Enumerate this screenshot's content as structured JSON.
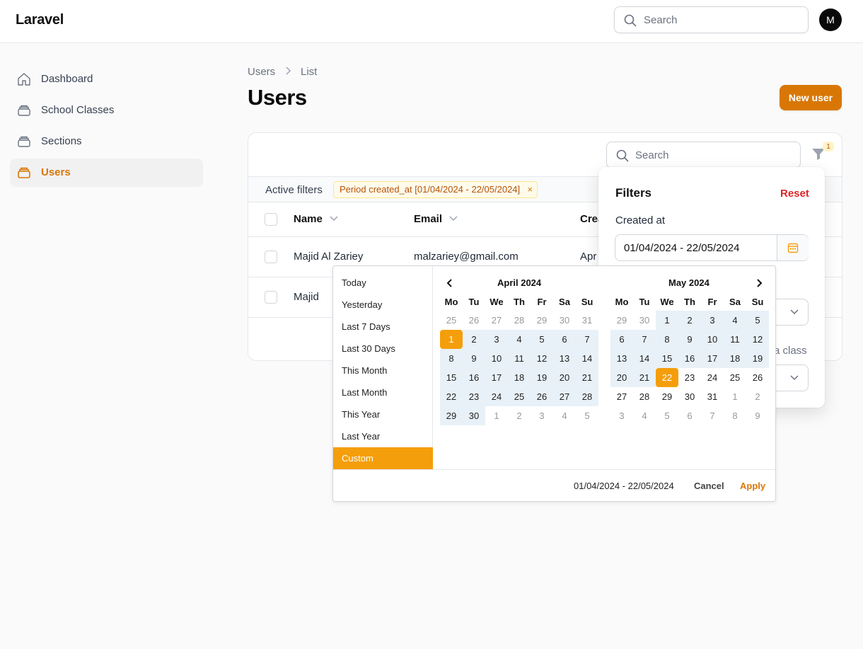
{
  "app": {
    "brand": "Laravel",
    "avatar_initial": "M"
  },
  "top_search": {
    "placeholder": "Search"
  },
  "sidebar": {
    "items": [
      {
        "label": "Dashboard",
        "icon": "home-icon",
        "active": false
      },
      {
        "label": "School Classes",
        "icon": "stack-icon",
        "active": false
      },
      {
        "label": "Sections",
        "icon": "stack-icon",
        "active": false
      },
      {
        "label": "Users",
        "icon": "stack-icon",
        "active": true
      }
    ]
  },
  "breadcrumb": {
    "items": [
      "Users",
      "List"
    ]
  },
  "page": {
    "title": "Users",
    "new_button": "New user"
  },
  "table": {
    "search_placeholder": "Search",
    "filter_count": "1",
    "active_filters_label": "Active filters",
    "active_filter_chip": "Period created_at [01/04/2024 - 22/05/2024]",
    "columns": [
      "Name",
      "Email",
      "Crea"
    ],
    "rows": [
      {
        "name": "Majid Al Zariey",
        "email": "malzariey@gmail.com",
        "created": "Apr"
      },
      {
        "name": "Majid",
        "email": "",
        "created": ""
      }
    ]
  },
  "filters_panel": {
    "title": "Filters",
    "reset": "Reset",
    "created_at_label": "Created at",
    "created_at_value": "01/04/2024 - 22/05/2024",
    "class_hint": "a class"
  },
  "date_picker": {
    "ranges": [
      "Today",
      "Yesterday",
      "Last 7 Days",
      "Last 30 Days",
      "This Month",
      "Last Month",
      "This Year",
      "Last Year",
      "Custom"
    ],
    "active_range": "Custom",
    "weekdays": [
      "Mo",
      "Tu",
      "We",
      "Th",
      "Fr",
      "Sa",
      "Su"
    ],
    "left_month": {
      "title": "April 2024",
      "days": [
        [
          "25",
          "26",
          "27",
          "28",
          "29",
          "30",
          "31"
        ],
        [
          "1",
          "2",
          "3",
          "4",
          "5",
          "6",
          "7"
        ],
        [
          "8",
          "9",
          "10",
          "11",
          "12",
          "13",
          "14"
        ],
        [
          "15",
          "16",
          "17",
          "18",
          "19",
          "20",
          "21"
        ],
        [
          "22",
          "23",
          "24",
          "25",
          "26",
          "27",
          "28"
        ],
        [
          "29",
          "30",
          "1",
          "2",
          "3",
          "4",
          "5"
        ]
      ]
    },
    "right_month": {
      "title": "May 2024",
      "days": [
        [
          "29",
          "30",
          "1",
          "2",
          "3",
          "4",
          "5"
        ],
        [
          "6",
          "7",
          "8",
          "9",
          "10",
          "11",
          "12"
        ],
        [
          "13",
          "14",
          "15",
          "16",
          "17",
          "18",
          "19"
        ],
        [
          "20",
          "21",
          "22",
          "23",
          "24",
          "25",
          "26"
        ],
        [
          "27",
          "28",
          "29",
          "30",
          "31",
          "1",
          "2"
        ],
        [
          "3",
          "4",
          "5",
          "6",
          "7",
          "8",
          "9"
        ]
      ]
    },
    "selected_text": "01/04/2024 - 22/05/2024",
    "cancel": "Cancel",
    "apply": "Apply",
    "colors": {
      "accent": "#f59e0b",
      "range": "#e8f1f8"
    }
  }
}
